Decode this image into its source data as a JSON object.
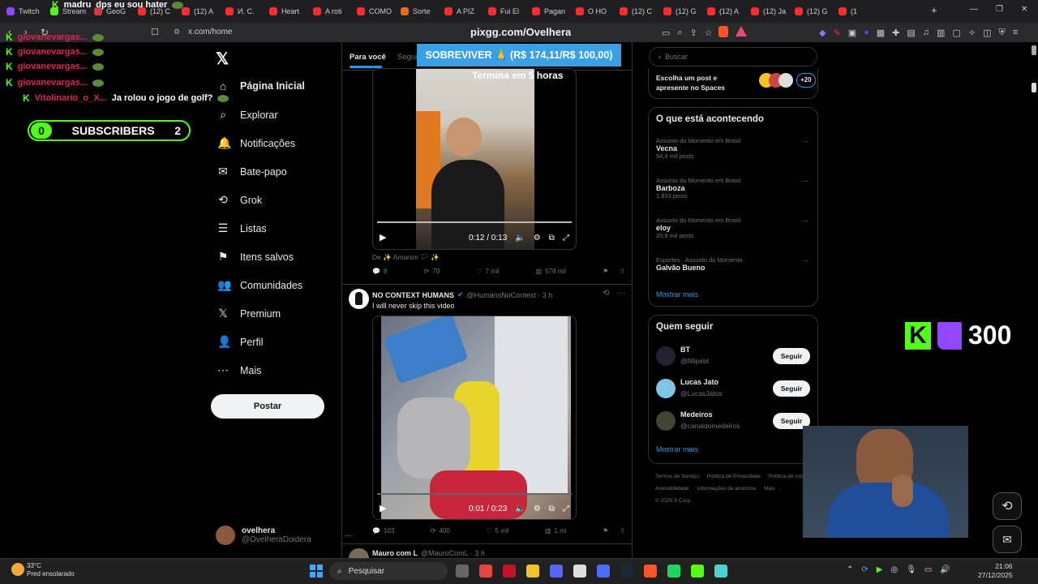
{
  "browser": {
    "tabs": [
      {
        "label": "Twitch",
        "color": "#9146ff"
      },
      {
        "label": "Stream",
        "color": "#53fc18"
      },
      {
        "label": "GeoG",
        "color": "#d03b3b"
      },
      {
        "label": "(12) C",
        "color": "#ff2d2d"
      },
      {
        "label": "(12) A",
        "color": "#ff2d2d"
      },
      {
        "label": "И. С.",
        "color": "#ff2d2d"
      },
      {
        "label": "Heart",
        "color": "#ff2d2d"
      },
      {
        "label": "A roti",
        "color": "#ff2d2d"
      },
      {
        "label": "COMO",
        "color": "#ff2d2d"
      },
      {
        "label": "Sorte",
        "color": "#e86a1e"
      },
      {
        "label": "A PIZ",
        "color": "#ff2d2d"
      },
      {
        "label": "Fui El",
        "color": "#ff2d2d"
      },
      {
        "label": "Pagan",
        "color": "#ff2d2d"
      },
      {
        "label": "O HO",
        "color": "#ff2d2d"
      },
      {
        "label": "(12) C",
        "color": "#ff2d2d"
      },
      {
        "label": "(12) G",
        "color": "#ff2d2d"
      },
      {
        "label": "(12) A",
        "color": "#ff2d2d"
      },
      {
        "label": "(12) Ja",
        "color": "#ff2d2d"
      },
      {
        "label": "(12) G",
        "color": "#ff2d2d"
      },
      {
        "label": "(1",
        "color": "#ff2d2d"
      }
    ],
    "url_left": "x.com/home",
    "url_center": "pixgg.com/Ovelhera"
  },
  "overlay": {
    "chat": [
      {
        "user": "madru",
        "msg": "dps eu sou hater"
      },
      {
        "user": "giovanevargas...",
        "msg": ""
      },
      {
        "user": "giovanevargas...",
        "msg": ""
      },
      {
        "user": "giovanevargas...",
        "msg": ""
      },
      {
        "user": "giovanevargas...",
        "msg": ""
      },
      {
        "user": "Vitolinario_o_X...",
        "msg": "Ja rolou o jogo de golf?"
      }
    ],
    "subs_current": "0",
    "subs_label": "SUBSCRIBERS",
    "subs_goal": "2",
    "banner": "SOBREVIVER 🙏 (R$ 174,11/R$ 100,00)",
    "kick_count": "300"
  },
  "nav": {
    "items": [
      {
        "label": "Página Inicial",
        "icon": "home-icon"
      },
      {
        "label": "Explorar",
        "icon": "search-icon"
      },
      {
        "label": "Notificações",
        "icon": "bell-icon"
      },
      {
        "label": "Bate-papo",
        "icon": "mail-icon"
      },
      {
        "label": "Grok",
        "icon": "grok-icon"
      },
      {
        "label": "Listas",
        "icon": "list-icon"
      },
      {
        "label": "Itens salvos",
        "icon": "bookmark-icon"
      },
      {
        "label": "Comunidades",
        "icon": "people-icon"
      },
      {
        "label": "Premium",
        "icon": "x-icon"
      },
      {
        "label": "Perfil",
        "icon": "person-icon"
      },
      {
        "label": "Mais",
        "icon": "more-icon"
      }
    ],
    "post_label": "Postar",
    "me_name": "ovelhera",
    "me_handle": "@OvelheraDoidera"
  },
  "feed": {
    "tab_for_you": "Para você",
    "tab_following": "Segui",
    "post1": {
      "video_overlay": "Termina em 5 horas",
      "time": "0:12 / 0:13",
      "from": "De ✨ Amanim 🏳 ✨",
      "replies": "8",
      "reposts": "70",
      "likes": "7 mil",
      "views": "578 mil"
    },
    "post2": {
      "name": "NO CONTEXT HUMANS",
      "handle": "@HumansNoContext · 3 h",
      "text": "I will never skip this video",
      "time": "0:01 / 0:23",
      "replies": "103",
      "reposts": "400",
      "likes": "5 mil",
      "views": "1 mi"
    },
    "post3": {
      "name": "Mauro com L",
      "handle": "@MauroComL · 3 h"
    }
  },
  "sidebar": {
    "search_placeholder": "Buscar",
    "spaces_text": "Escolha um post e apresente no Spaces",
    "spaces_count": "+20",
    "trends_title": "O que está acontecendo",
    "trends": [
      {
        "meta": "Assunto do Momento em Brasil",
        "name": "Vecna",
        "posts": "94,4 mil posts"
      },
      {
        "meta": "Assunto do Momento em Brasil",
        "name": "Barboza",
        "posts": "1.933 posts"
      },
      {
        "meta": "Assunto do Momento em Brasil",
        "name": "eloy",
        "posts": "20,9 mil posts"
      },
      {
        "meta": "Esportes · Assunto do Momento",
        "name": "Galvão Bueno",
        "posts": ""
      }
    ],
    "show_more": "Mostrar mais",
    "who_title": "Quem seguir",
    "who": [
      {
        "name": "BT",
        "handle": "@fillipebt",
        "btn": "Seguir"
      },
      {
        "name": "Lucas Jato",
        "handle": "@LucasJatos",
        "btn": "Seguir"
      },
      {
        "name": "Medeiros",
        "handle": "@canaldomedeiros",
        "btn": "Seguir"
      }
    ],
    "show_more2": "Mostrar mais",
    "footer": [
      "Termos de Serviço",
      "Política de Privacidade",
      "Política de cookies",
      "Acessibilidade",
      "Informações de anúncios",
      "Mais ···",
      "© 2025 X Corp."
    ]
  },
  "taskbar": {
    "weather_temp": "33°C",
    "weather_desc": "Pred ensolarado",
    "search_label": "Pesquisar",
    "time": "21:06",
    "date": "27/12/2025"
  }
}
